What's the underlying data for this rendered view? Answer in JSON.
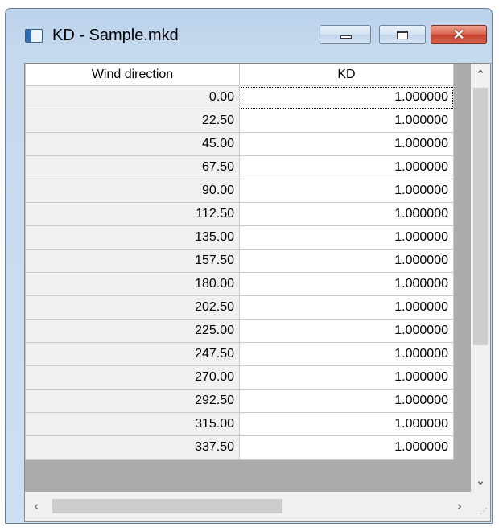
{
  "window": {
    "title": "KD - Sample.mkd"
  },
  "table": {
    "columns": [
      "Wind direction",
      "KD"
    ],
    "rows": [
      [
        "0.00",
        "1.000000"
      ],
      [
        "22.50",
        "1.000000"
      ],
      [
        "45.00",
        "1.000000"
      ],
      [
        "67.50",
        "1.000000"
      ],
      [
        "90.00",
        "1.000000"
      ],
      [
        "112.50",
        "1.000000"
      ],
      [
        "135.00",
        "1.000000"
      ],
      [
        "157.50",
        "1.000000"
      ],
      [
        "180.00",
        "1.000000"
      ],
      [
        "202.50",
        "1.000000"
      ],
      [
        "225.00",
        "1.000000"
      ],
      [
        "247.50",
        "1.000000"
      ],
      [
        "270.00",
        "1.000000"
      ],
      [
        "292.50",
        "1.000000"
      ],
      [
        "315.00",
        "1.000000"
      ],
      [
        "337.50",
        "1.000000"
      ]
    ]
  },
  "icons": {
    "app": "app-icon",
    "minimize": "minimize-icon",
    "maximize": "maximize-icon",
    "close": "close-icon",
    "scroll_up": "chevron-up-icon",
    "scroll_down": "chevron-down-icon",
    "scroll_left": "chevron-left-icon",
    "scroll_right": "chevron-right-icon"
  },
  "glyphs": {
    "close": "✕",
    "up": "⌃",
    "down": "⌄",
    "left": "‹",
    "right": "›",
    "grip": "⋰"
  }
}
